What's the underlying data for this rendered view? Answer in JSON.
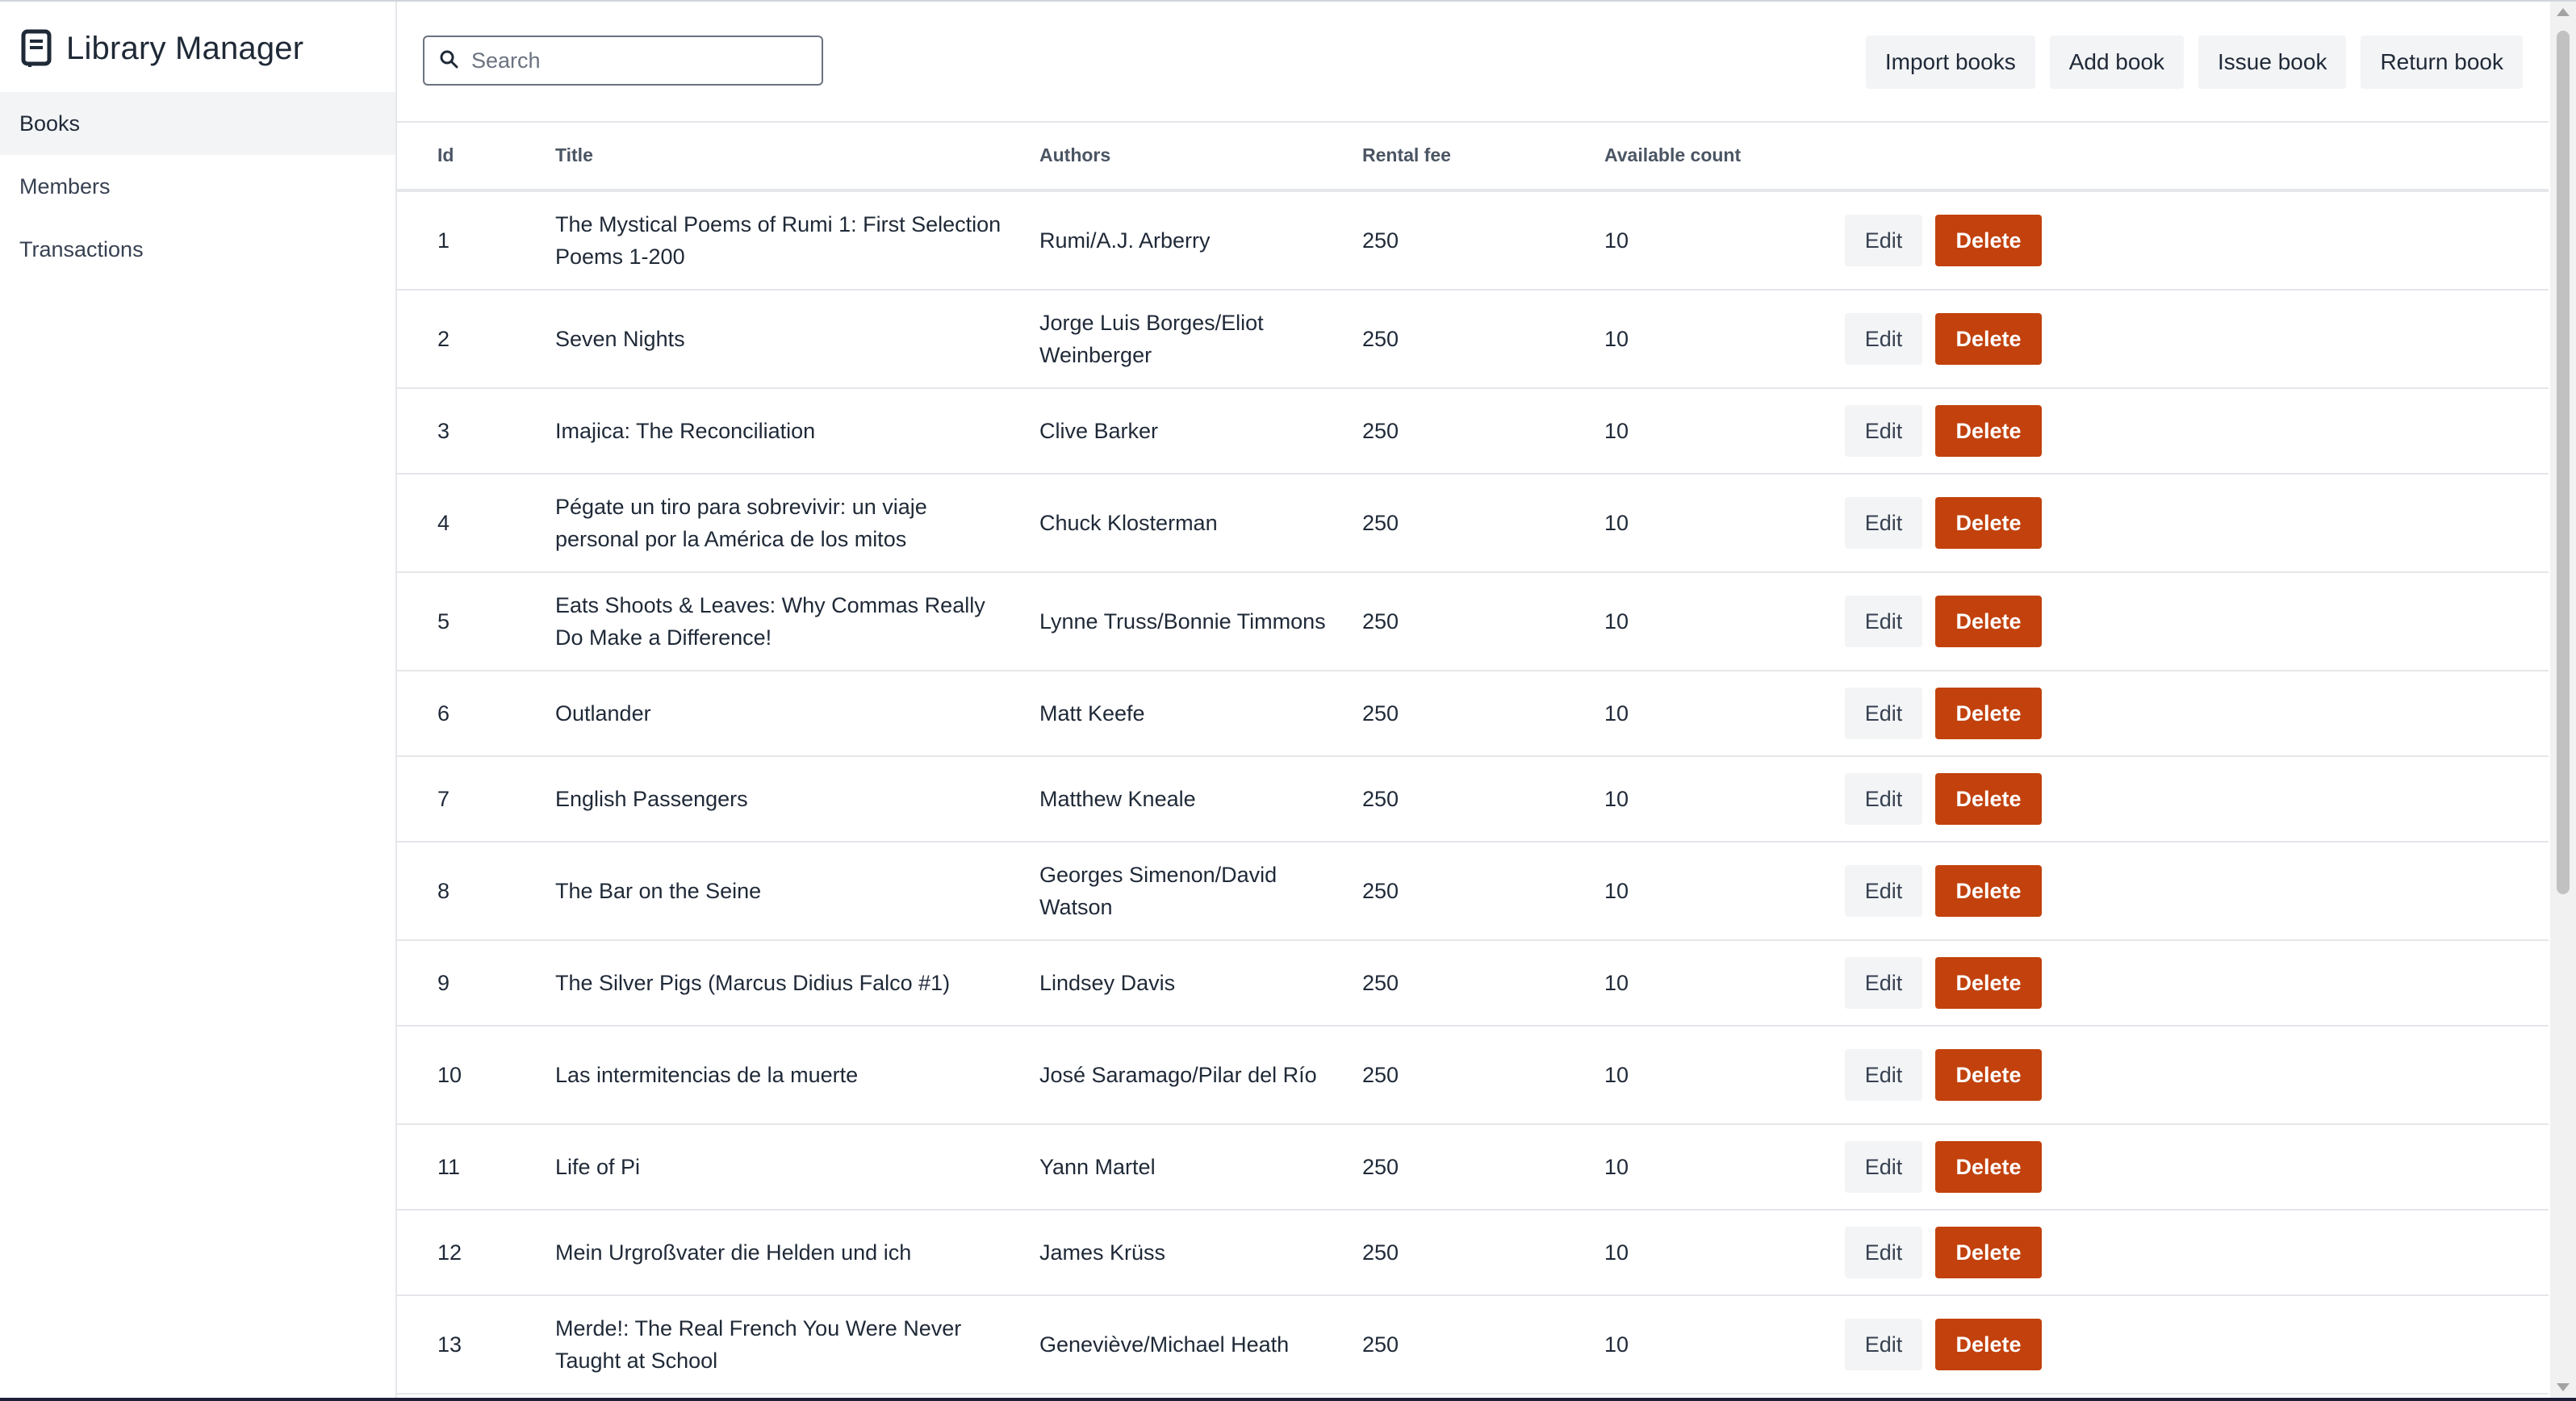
{
  "app": {
    "title": "Library Manager"
  },
  "sidebar": {
    "items": [
      {
        "label": "Books",
        "active": true
      },
      {
        "label": "Members",
        "active": false
      },
      {
        "label": "Transactions",
        "active": false
      }
    ]
  },
  "search": {
    "placeholder": "Search",
    "value": ""
  },
  "toolbar": {
    "import_label": "Import books",
    "add_label": "Add book",
    "issue_label": "Issue book",
    "return_label": "Return book"
  },
  "table": {
    "columns": [
      "Id",
      "Title",
      "Authors",
      "Rental fee",
      "Available count"
    ],
    "edit_label": "Edit",
    "delete_label": "Delete",
    "rows": [
      {
        "id": "1",
        "title": "The Mystical Poems of Rumi 1: First Selection Poems 1-200",
        "authors": "Rumi/A.J. Arberry",
        "fee": "250",
        "count": "10"
      },
      {
        "id": "2",
        "title": "Seven Nights",
        "authors": "Jorge Luis Borges/Eliot Weinberger",
        "fee": "250",
        "count": "10"
      },
      {
        "id": "3",
        "title": "Imajica: The Reconciliation",
        "authors": "Clive Barker",
        "fee": "250",
        "count": "10"
      },
      {
        "id": "4",
        "title": "Pégate un tiro para sobrevivir: un viaje personal por la América de los mitos",
        "authors": "Chuck Klosterman",
        "fee": "250",
        "count": "10"
      },
      {
        "id": "5",
        "title": "Eats Shoots & Leaves: Why Commas Really Do Make a Difference!",
        "authors": "Lynne Truss/Bonnie Timmons",
        "fee": "250",
        "count": "10"
      },
      {
        "id": "6",
        "title": "Outlander",
        "authors": "Matt Keefe",
        "fee": "250",
        "count": "10"
      },
      {
        "id": "7",
        "title": "English Passengers",
        "authors": "Matthew Kneale",
        "fee": "250",
        "count": "10"
      },
      {
        "id": "8",
        "title": "The Bar on the Seine",
        "authors": "Georges Simenon/David Watson",
        "fee": "250",
        "count": "10"
      },
      {
        "id": "9",
        "title": "The Silver Pigs (Marcus Didius Falco #1)",
        "authors": "Lindsey Davis",
        "fee": "250",
        "count": "10"
      },
      {
        "id": "10",
        "title": "Las intermitencias de la muerte",
        "authors": "José Saramago/Pilar del Río",
        "fee": "250",
        "count": "10"
      },
      {
        "id": "11",
        "title": "Life of Pi",
        "authors": "Yann Martel",
        "fee": "250",
        "count": "10"
      },
      {
        "id": "12",
        "title": "Mein Urgroßvater die Helden und ich",
        "authors": "James Krüss",
        "fee": "250",
        "count": "10"
      },
      {
        "id": "13",
        "title": "Merde!: The Real French You Were Never Taught at School",
        "authors": "Geneviève/Michael Heath",
        "fee": "250",
        "count": "10"
      }
    ]
  },
  "icons": {
    "brand": "book-icon",
    "search": "search-icon"
  },
  "colors": {
    "delete": "#c2410c",
    "gray_button": "#f3f4f6",
    "active_nav": "#f3f4f6"
  }
}
